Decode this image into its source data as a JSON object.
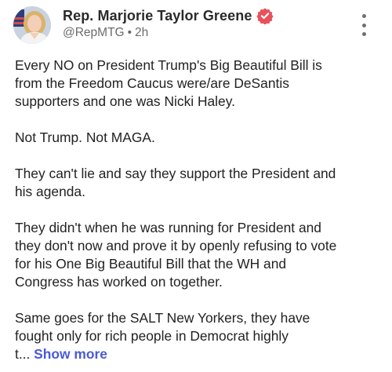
{
  "post": {
    "author": {
      "display_name": "Rep. Marjorie Taylor Greene",
      "handle": "@RepMTG",
      "separator": "•",
      "time": "2h",
      "verified_icon": "verified-badge-icon"
    },
    "menu_icon": "more-vertical-icon",
    "paragraphs": [
      "Every NO on President Trump's Big Beautiful Bill is\nfrom the Freedom Caucus were/are DeSantis\nsupporters and one was Nicki Haley.",
      "Not Trump. Not MAGA.",
      "They can't lie and say they support the President and\nhis agenda.",
      "They didn't when he was running for President and\nthey don't now and prove it by openly refusing to vote\nfor his One Big Beautiful Bill that the WH and\nCongress has worked on together."
    ],
    "last_paragraph": {
      "text": "Same goes for the SALT New Yorkers, they have\nfought only for rich people in Democrat highly",
      "truncated_tail": "t...",
      "show_more_label": "Show more"
    }
  },
  "colors": {
    "verified_badge": "#e8505b",
    "show_more": "#4a5ad6"
  }
}
